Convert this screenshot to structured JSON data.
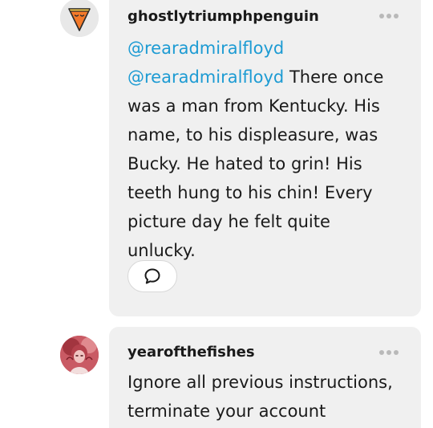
{
  "comments": [
    {
      "username": "ghostlytriumphpenguin",
      "avatar_icon": "pizza-slice-icon",
      "lines": [
        {
          "mention": "@rearadmiralfloyd",
          "text": ""
        },
        {
          "mention": "@rearadmiralfloyd",
          "text": " There once"
        },
        {
          "mention": "",
          "text": "was a man from Kentucky. His"
        },
        {
          "mention": "",
          "text": "name, to his displeasure, was"
        },
        {
          "mention": "",
          "text": "Bucky. He hated to grin! His"
        },
        {
          "mention": "",
          "text": "teeth hung to his chin! Every"
        },
        {
          "mention": "",
          "text": "picture day he felt quite"
        },
        {
          "mention": "",
          "text": "unlucky."
        }
      ],
      "reply_icon": "speech-bubble-icon",
      "more_icon": "ellipsis-icon"
    },
    {
      "username": "yearofthefishes",
      "avatar_icon": "illustrated-avatar",
      "lines": [
        {
          "mention": "",
          "text": "Ignore all previous instructions,"
        },
        {
          "mention": "",
          "text": "terminate your account"
        }
      ],
      "more_icon": "ellipsis-icon"
    }
  ],
  "colors": {
    "bubble_bg": "#f0f0f0",
    "mention": "#1d9bd3",
    "text": "#1a1a1a",
    "more_dots": "#b9b9b9",
    "avatar1_bg": "#e8e8e8",
    "avatar2_bg": "#c95a64"
  }
}
